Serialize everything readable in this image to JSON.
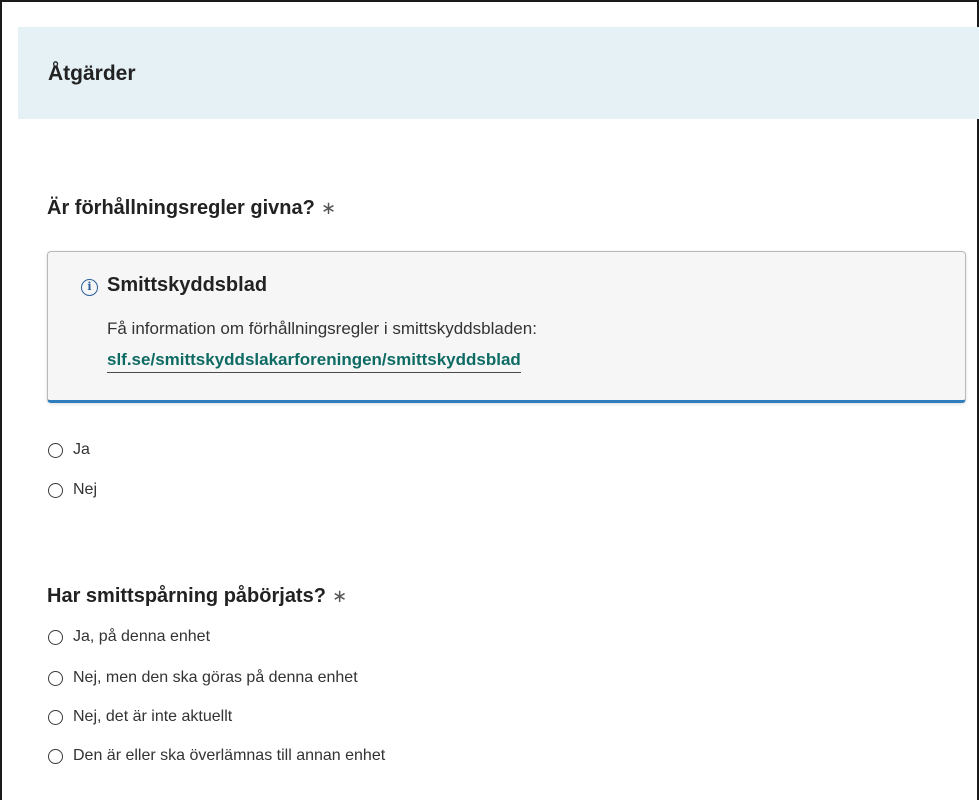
{
  "section": {
    "title": "Åtgärder"
  },
  "question1": {
    "label": "Är förhållningsregler givna?",
    "required_mark": "∗",
    "info": {
      "icon": "info-icon",
      "title": "Smittskyddsblad",
      "text": "Få information om förhållningsregler i smittskyddsbladen:",
      "link": "slf.se/smittskyddslakarforeningen/smittskyddsblad"
    },
    "options": [
      "Ja",
      "Nej"
    ]
  },
  "question2": {
    "label": "Har smittspårning påbörjats?",
    "required_mark": "∗",
    "options": [
      "Ja, på denna enhet",
      "Nej, men den ska göras på denna enhet",
      "Nej, det är inte aktuellt",
      "Den är eller ska överlämnas till annan enhet"
    ]
  },
  "colors": {
    "header_bg": "#e5f1f5",
    "link": "#0e6b64",
    "info_accent": "#2f7dbc"
  }
}
